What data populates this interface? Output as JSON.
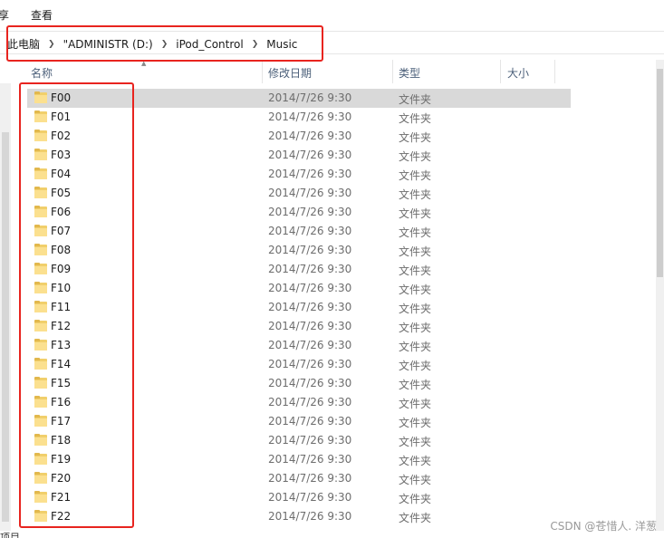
{
  "ribbon": {
    "tab_share_fragment": "享",
    "tab_view": "查看"
  },
  "breadcrumb": {
    "items": [
      "此电脑",
      "\"ADMINISTR (D:)",
      "iPod_Control",
      "Music"
    ],
    "separator_icon": "chevron-right-icon"
  },
  "columns": {
    "name": "名称",
    "modified": "修改日期",
    "type": "类型",
    "size": "大小"
  },
  "files": [
    {
      "name": "F00",
      "modified": "2014/7/26 9:30",
      "type": "文件夹"
    },
    {
      "name": "F01",
      "modified": "2014/7/26 9:30",
      "type": "文件夹"
    },
    {
      "name": "F02",
      "modified": "2014/7/26 9:30",
      "type": "文件夹"
    },
    {
      "name": "F03",
      "modified": "2014/7/26 9:30",
      "type": "文件夹"
    },
    {
      "name": "F04",
      "modified": "2014/7/26 9:30",
      "type": "文件夹"
    },
    {
      "name": "F05",
      "modified": "2014/7/26 9:30",
      "type": "文件夹"
    },
    {
      "name": "F06",
      "modified": "2014/7/26 9:30",
      "type": "文件夹"
    },
    {
      "name": "F07",
      "modified": "2014/7/26 9:30",
      "type": "文件夹"
    },
    {
      "name": "F08",
      "modified": "2014/7/26 9:30",
      "type": "文件夹"
    },
    {
      "name": "F09",
      "modified": "2014/7/26 9:30",
      "type": "文件夹"
    },
    {
      "name": "F10",
      "modified": "2014/7/26 9:30",
      "type": "文件夹"
    },
    {
      "name": "F11",
      "modified": "2014/7/26 9:30",
      "type": "文件夹"
    },
    {
      "name": "F12",
      "modified": "2014/7/26 9:30",
      "type": "文件夹"
    },
    {
      "name": "F13",
      "modified": "2014/7/26 9:30",
      "type": "文件夹"
    },
    {
      "name": "F14",
      "modified": "2014/7/26 9:30",
      "type": "文件夹"
    },
    {
      "name": "F15",
      "modified": "2014/7/26 9:30",
      "type": "文件夹"
    },
    {
      "name": "F16",
      "modified": "2014/7/26 9:30",
      "type": "文件夹"
    },
    {
      "name": "F17",
      "modified": "2014/7/26 9:30",
      "type": "文件夹"
    },
    {
      "name": "F18",
      "modified": "2014/7/26 9:30",
      "type": "文件夹"
    },
    {
      "name": "F19",
      "modified": "2014/7/26 9:30",
      "type": "文件夹"
    },
    {
      "name": "F20",
      "modified": "2014/7/26 9:30",
      "type": "文件夹"
    },
    {
      "name": "F21",
      "modified": "2014/7/26 9:30",
      "type": "文件夹"
    },
    {
      "name": "F22",
      "modified": "2014/7/26 9:30",
      "type": "文件夹"
    }
  ],
  "selected_index": 0,
  "status_bar": {
    "text_fragment": "项目"
  },
  "watermark": "CSDN @苍惜人. 洋葱",
  "colors": {
    "annotation": "#e8241f",
    "selected_row": "#d9d9d9",
    "folder": "#f1cf6b"
  }
}
